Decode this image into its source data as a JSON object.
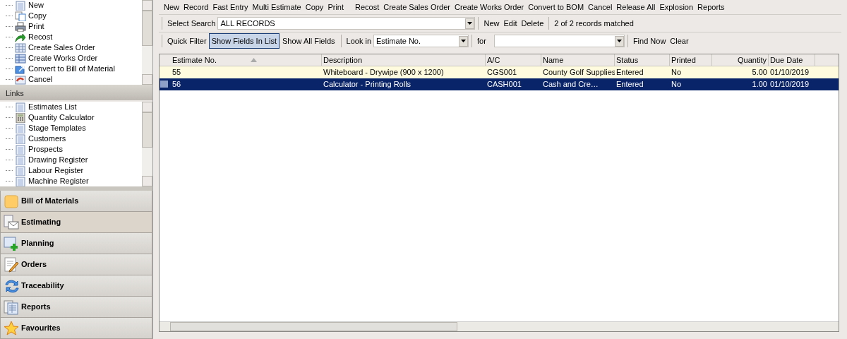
{
  "tasks": [
    {
      "label": "New"
    },
    {
      "label": "Copy"
    },
    {
      "label": "Print"
    },
    {
      "label": "Recost"
    },
    {
      "label": "Create Sales Order"
    },
    {
      "label": "Create Works Order"
    },
    {
      "label": "Convert to Bill of Material"
    },
    {
      "label": "Cancel"
    }
  ],
  "links": {
    "title": "Links",
    "items": [
      {
        "label": "Estimates List"
      },
      {
        "label": "Quantity Calculator"
      },
      {
        "label": "Stage Templates"
      },
      {
        "label": "Customers"
      },
      {
        "label": "Prospects"
      },
      {
        "label": "Drawing Register"
      },
      {
        "label": "Labour Register"
      },
      {
        "label": "Machine Register"
      }
    ]
  },
  "modules": [
    {
      "label": "Bill of Materials",
      "selected": false
    },
    {
      "label": "Estimating",
      "selected": true
    },
    {
      "label": "Planning",
      "selected": false
    },
    {
      "label": "Orders",
      "selected": false
    },
    {
      "label": "Traceability",
      "selected": false
    },
    {
      "label": "Reports",
      "selected": false
    },
    {
      "label": "Favourites",
      "selected": false
    }
  ],
  "toolbar": [
    [
      "New",
      "Record",
      "Fast Entry",
      "Multi Estimate",
      "Copy",
      "Print"
    ],
    [
      "Recost",
      "Create Sales Order",
      "Create Works Order",
      "Convert to BOM",
      "Cancel",
      "Release All",
      "Explosion",
      "Reports"
    ]
  ],
  "search_bar": {
    "label": "Select Search",
    "value": "ALL RECORDS",
    "buttons": [
      "New",
      "Edit",
      "Delete"
    ],
    "status": "2 of 2 records matched"
  },
  "filter_bar": {
    "quick_filter": "Quick Filter",
    "toggles": [
      {
        "label": "Show Fields In List",
        "pressed": true
      },
      {
        "label": "Show All Fields",
        "pressed": false
      }
    ],
    "look_in_label": "Look in",
    "look_in_value": "Estimate No.",
    "for_label": "for",
    "buttons": [
      "Find Now",
      "Clear"
    ]
  },
  "grid": {
    "columns": [
      {
        "label": "Estimate No.",
        "sorted": true,
        "numeric": false
      },
      {
        "label": "Description",
        "sorted": false,
        "numeric": false
      },
      {
        "label": "A/C",
        "sorted": false,
        "numeric": false
      },
      {
        "label": "Name",
        "sorted": false,
        "numeric": false
      },
      {
        "label": "Status",
        "sorted": false,
        "numeric": false
      },
      {
        "label": "Printed",
        "sorted": false,
        "numeric": false
      },
      {
        "label": "Quantity",
        "sorted": false,
        "numeric": true
      },
      {
        "label": "Due Date",
        "sorted": false,
        "numeric": false
      }
    ],
    "rows": [
      {
        "selected": false,
        "highlighted": true,
        "cells": [
          "55",
          "Whiteboard - Drywipe (900 x 1200)",
          "CGS001",
          "County Golf Supplies",
          "Entered",
          "No",
          "5.00",
          "01/10/2019"
        ]
      },
      {
        "selected": true,
        "highlighted": false,
        "cells": [
          "56",
          "Calculator - Printing Rolls",
          "CASH001",
          "Cash and Cre…",
          "Entered",
          "No",
          "1.00",
          "01/10/2019"
        ]
      }
    ]
  }
}
